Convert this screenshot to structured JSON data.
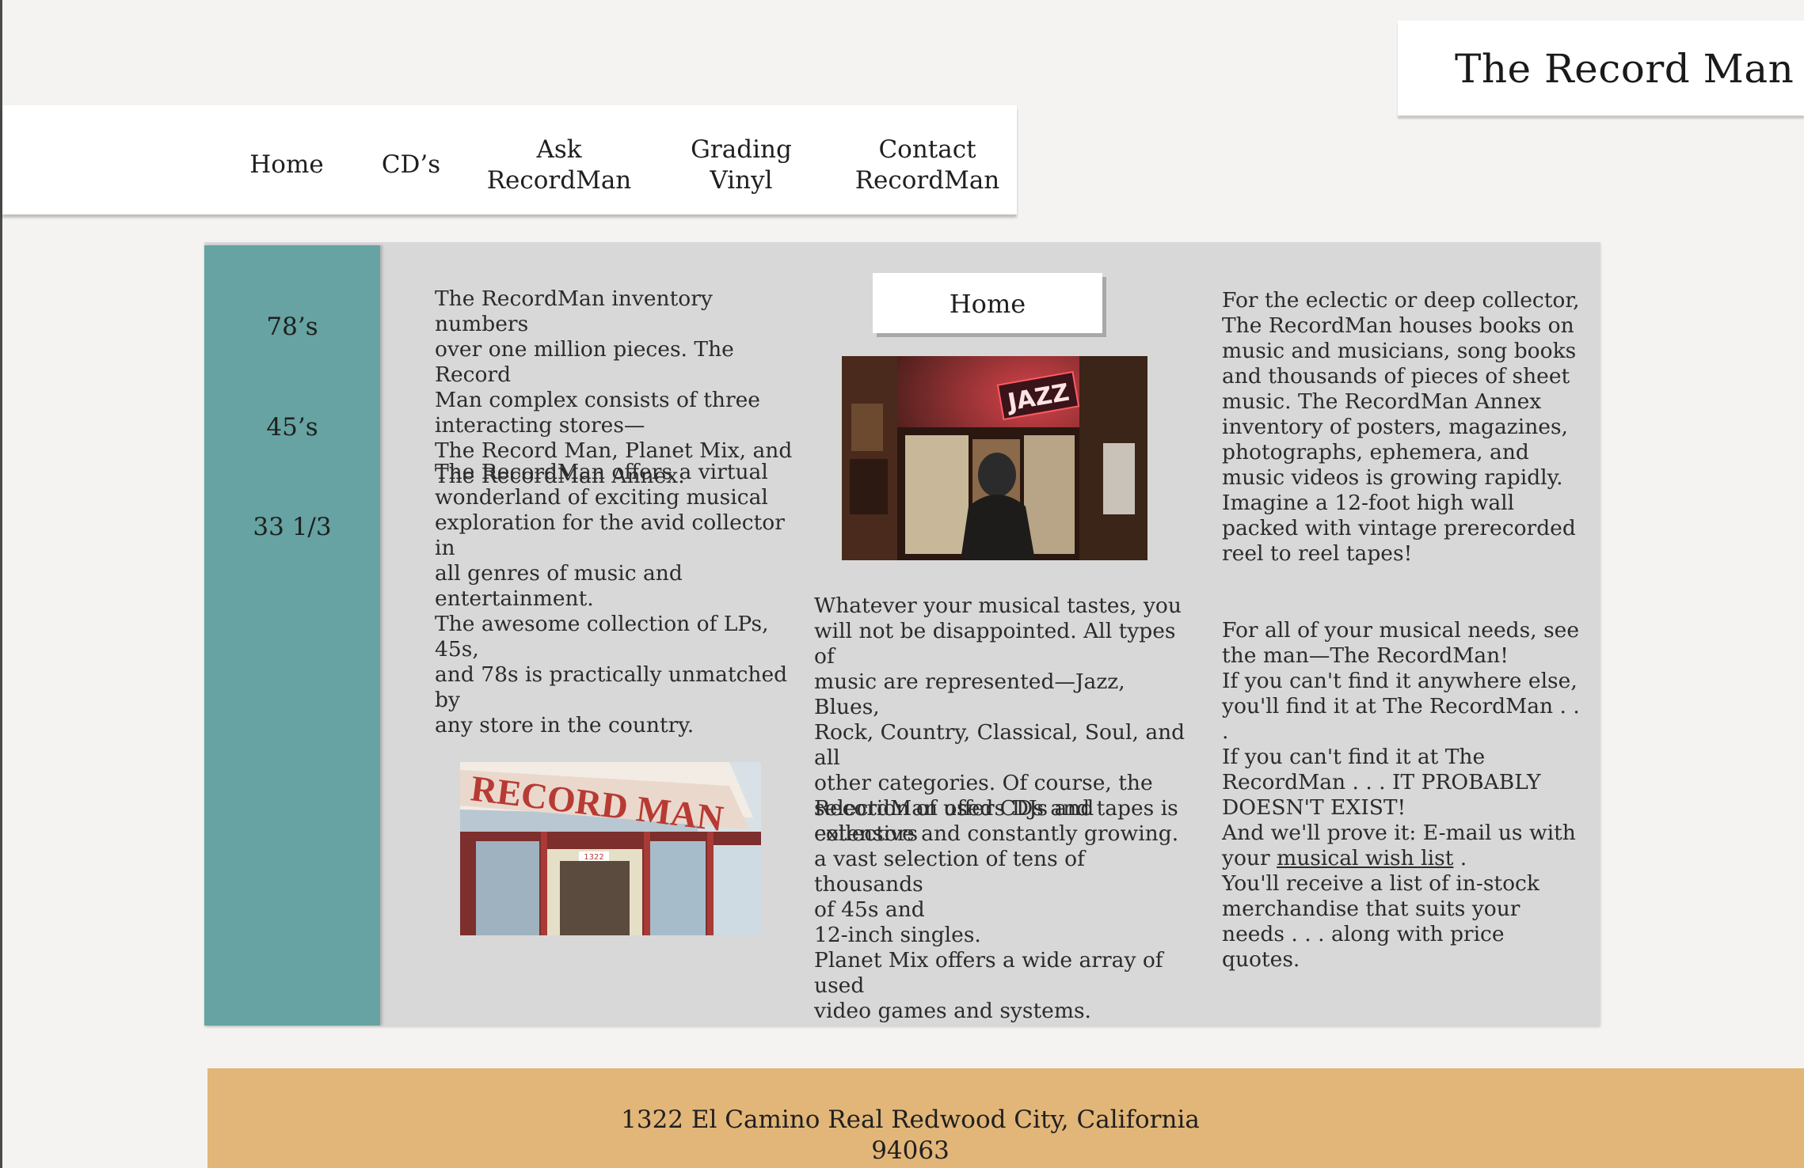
{
  "site": {
    "title": "The Record Man"
  },
  "nav": {
    "items": [
      {
        "label": "Home"
      },
      {
        "label": "CD’s"
      },
      {
        "label": "Ask\nRecordMan"
      },
      {
        "label": "Grading\nVinyl"
      },
      {
        "label": "Contact\nRecordMan"
      }
    ]
  },
  "sidebar": {
    "items": [
      {
        "label": "78’s"
      },
      {
        "label": "45’s"
      },
      {
        "label": "33 1/3"
      }
    ]
  },
  "main": {
    "badge": "Home",
    "col1": {
      "p1": "The RecordMan inventory numbers\nover one million pieces.  The Record\nMan complex consists of three\ninteracting stores—\nThe Record Man, Planet Mix, and\nThe RecordMan Annex.",
      "p2": "The RecordMan offers a virtual\nwonderland of exciting musical\nexploration for the avid collector in\nall genres of music and\nentertainment.",
      "p3": "The awesome collection of LPs, 45s,\nand 78s is practically unmatched by\nany store in the country."
    },
    "col2": {
      "p1": "Whatever your musical tastes, you\nwill not be disappointed. All types of\nmusic are represented—Jazz, Blues,\nRock, Country, Classical, Soul, and all\nother categories. Of course, the\nselection of used CDs and tapes is\nextensive and constantly growing.",
      "p2": "RecordMan offers DJs and collectors\na vast selection of tens of thousands\nof 45s and\n12-inch singles.\nPlanet Mix offers a wide array of used\nvideo games and systems."
    },
    "col3": {
      "p1": "For the eclectic or deep collector,\nThe RecordMan houses books on\nmusic and musicians, song books\nand thousands of pieces of sheet\nmusic. The RecordMan Annex\ninventory of posters, magazines,\nphotographs, ephemera, and\nmusic videos is growing rapidly.\nImagine a 12-foot high wall\npacked with vintage prerecorded\nreel to reel tapes!",
      "p2_before": "For all of your musical needs, see\nthe man—The RecordMan!\nIf you can't find it anywhere else,\nyou'll find it at The RecordMan . . .\nIf you can't find it at The\nRecordMan . . . IT PROBABLY\nDOESN'T EXIST!\nAnd we'll prove it: E-mail us with\nyour ",
      "link": "musical wish list",
      "p2_after": " .\nYou'll receive a list of in-stock\nmerchandise that suits your\nneeds .  . . along with price quotes."
    },
    "images": {
      "jazz": {
        "sign": "JAZZ"
      },
      "storefront": {
        "sign": "RECORD MAN",
        "number": "1322"
      }
    }
  },
  "footer": {
    "address": "1322 El Camino Real Redwood City, California\n94063"
  },
  "colors": {
    "background": "#f4f3f1",
    "sidebar": "#66a3a2",
    "panel": "#d8d8d8",
    "footer": "#e2b678"
  }
}
